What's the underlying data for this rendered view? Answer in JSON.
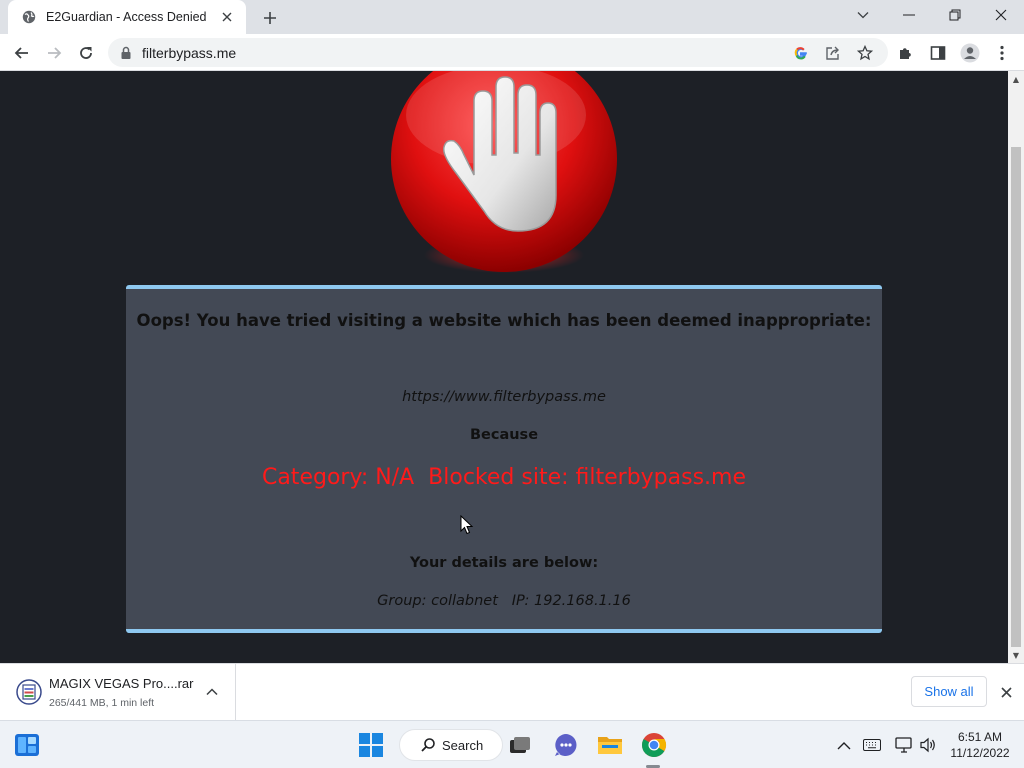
{
  "browser": {
    "tab": {
      "title": "E2Guardian - Access Denied"
    },
    "url": "filterbypass.me"
  },
  "block_page": {
    "headline": "Oops! You have tried visiting a website which has been deemed inappropriate:",
    "blocked_url": "https://www.filterbypass.me",
    "because_label": "Because",
    "reason": "Category: N/A  Blocked site: filterbypass.me",
    "details_label": "Your details are below:",
    "details": "Group: collabnet   IP: 192.168.1.16"
  },
  "download_bar": {
    "item": {
      "name": "MAGIX VEGAS Pro....rar",
      "status": "265/441 MB, 1 min left"
    },
    "show_all_label": "Show all"
  },
  "taskbar": {
    "search_label": "Search",
    "time": "6:51 AM",
    "date": "11/12/2022"
  },
  "colors": {
    "page_background": "#1d2026",
    "panel_background": "#434955",
    "panel_border": "#8ec8f0",
    "reason_text": "#ff1a1a",
    "show_all_link": "#1a73e8"
  },
  "icons": {
    "tab_favicon": "globe-icon",
    "new_tab": "plus-icon",
    "back": "back-arrow-icon",
    "forward": "forward-arrow-icon",
    "reload": "reload-icon",
    "lock": "lock-icon",
    "google": "google-icon",
    "share": "share-icon",
    "bookmark": "star-icon",
    "extensions": "puzzle-icon",
    "side_panel": "side-panel-icon",
    "profile": "profile-icon",
    "menu": "kebab-menu-icon",
    "stop_hand": "stop-hand-icon"
  }
}
